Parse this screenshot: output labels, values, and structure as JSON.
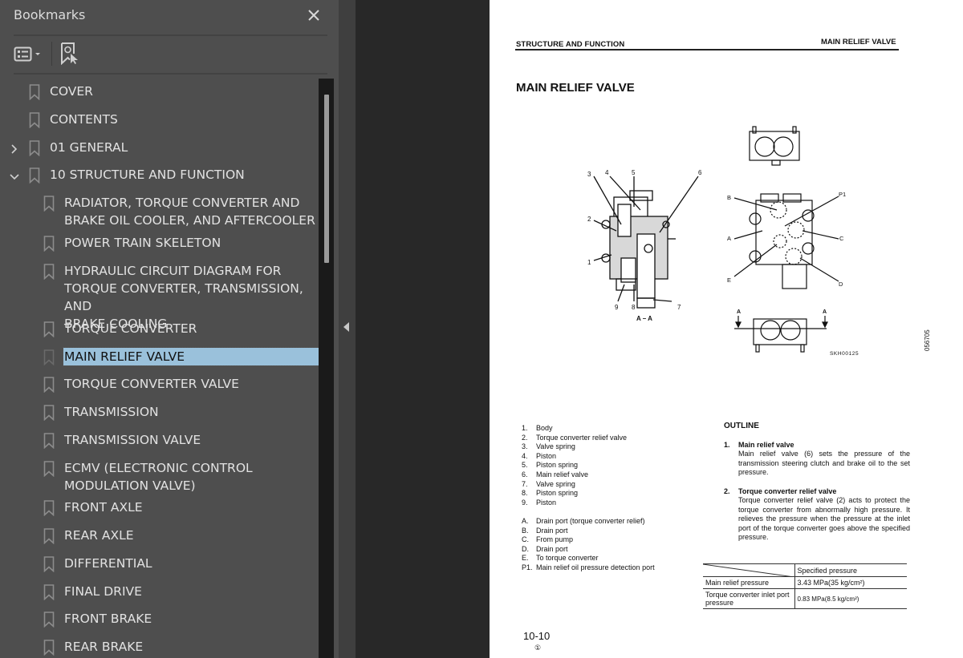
{
  "panel": {
    "title": "Bookmarks",
    "icons": {
      "close": "close-icon",
      "options": "list-options-icon",
      "find": "find-current-bookmark-icon"
    }
  },
  "bookmarks": [
    {
      "label": "COVER",
      "level": 0,
      "expander": "none"
    },
    {
      "label": "CONTENTS",
      "level": 0,
      "expander": "none"
    },
    {
      "label": "01 GENERAL",
      "level": 0,
      "expander": "collapsed"
    },
    {
      "label": "10 STRUCTURE AND FUNCTION",
      "level": 0,
      "expander": "expanded"
    },
    {
      "label": "RADIATOR, TORQUE CONVERTER AND\nBRAKE OIL COOLER, AND AFTERCOOLER",
      "level": 1
    },
    {
      "label": "POWER TRAIN SKELETON",
      "level": 1
    },
    {
      "label": "HYDRAULIC CIRCUIT DIAGRAM FOR\nTORQUE CONVERTER, TRANSMISSION, AND\nBRAKE COOLING",
      "level": 1
    },
    {
      "label": "TORQUE CONVERTER",
      "level": 1
    },
    {
      "label": "MAIN RELIEF VALVE",
      "level": 1,
      "selected": true
    },
    {
      "label": "TORQUE CONVERTER VALVE",
      "level": 1
    },
    {
      "label": "TRANSMISSION",
      "level": 1
    },
    {
      "label": "TRANSMISSION VALVE",
      "level": 1
    },
    {
      "label": "ECMV (ELECTRONIC CONTROL\nMODULATION VALVE)",
      "level": 1
    },
    {
      "label": "FRONT AXLE",
      "level": 1
    },
    {
      "label": "REAR AXLE",
      "level": 1
    },
    {
      "label": "DIFFERENTIAL",
      "level": 1
    },
    {
      "label": "FINAL DRIVE",
      "level": 1
    },
    {
      "label": "FRONT BRAKE",
      "level": 1
    },
    {
      "label": "REAR BRAKE",
      "level": 1
    }
  ],
  "colors": {
    "panel_bg": "#4e4e4e",
    "selection_bg": "#9ac1db",
    "viewer_bg": "#282828",
    "page_bg": "#ffffff"
  },
  "document": {
    "header_left": "STRUCTURE AND FUNCTION",
    "header_right": "MAIN RELIEF VALVE",
    "title": "MAIN RELIEF VALVE",
    "figure": {
      "section_label": "A – A",
      "code": "SKH00125",
      "side_code": "056705",
      "callouts_numbers": [
        "1",
        "2",
        "3",
        "4",
        "5",
        "6",
        "7",
        "8",
        "9"
      ],
      "callouts_letters": [
        "A",
        "B",
        "C",
        "D",
        "E",
        "P1"
      ]
    },
    "parts": [
      {
        "n": "1.",
        "t": "Body"
      },
      {
        "n": "2.",
        "t": "Torque converter relief valve"
      },
      {
        "n": "3.",
        "t": "Valve spring"
      },
      {
        "n": "4.",
        "t": "Piston"
      },
      {
        "n": "5.",
        "t": "Piston spring"
      },
      {
        "n": "6.",
        "t": "Main relief valve"
      },
      {
        "n": "7.",
        "t": "Valve spring"
      },
      {
        "n": "8.",
        "t": "Piston spring"
      },
      {
        "n": "9.",
        "t": "Piston"
      }
    ],
    "ports": [
      {
        "n": "A.",
        "t": "Drain port (torque converter relief)"
      },
      {
        "n": "B.",
        "t": "Drain port"
      },
      {
        "n": "C.",
        "t": "From pump"
      },
      {
        "n": "D.",
        "t": "Drain port"
      },
      {
        "n": "E.",
        "t": "To torque converter"
      },
      {
        "n": "P1.",
        "t": "Main relief oil pressure detection port"
      }
    ],
    "outline": {
      "heading": "OUTLINE",
      "sections": [
        {
          "num": "1.",
          "title": "Main relief valve",
          "text": "Main relief valve (6) sets the pressure of the transmission steering clutch and brake oil to the set pressure."
        },
        {
          "num": "2.",
          "title": "Torque converter relief valve",
          "text": "Torque converter relief valve (2) acts to protect the torque converter from abnormally high pressure. It relieves the pressure when the pressure at the inlet port of the torque converter goes above the specified pressure."
        }
      ]
    },
    "spec_table": {
      "header": "Specified pressure",
      "rows": [
        {
          "label": "Main relief pressure",
          "value": "3.43 MPa(35 kg/cm²)"
        },
        {
          "label": "Torque converter inlet port pressure",
          "value": "0.83 MPa(8.5 kg/cm²)"
        }
      ]
    },
    "page_number": "10-10",
    "revision_mark": "①"
  }
}
